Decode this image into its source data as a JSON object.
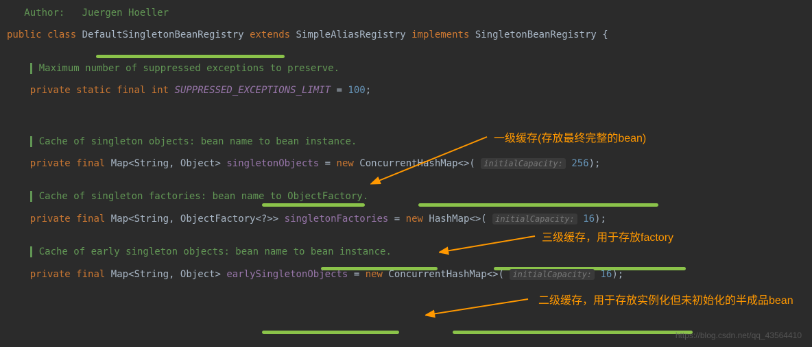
{
  "author_label": "Author:",
  "author_name": "Juergen Hoeller",
  "class_decl": {
    "public": "public",
    "class": "class",
    "name": "DefaultSingletonBeanRegistry",
    "extends": "extends",
    "parent": "SimpleAliasRegistry",
    "implements": "implements",
    "iface": "SingletonBeanRegistry",
    "brace": "{"
  },
  "comment1": "Maximum number of suppressed exceptions to preserve.",
  "field1": {
    "private": "private",
    "static": "static",
    "final": "final",
    "type": "int",
    "name": "SUPPRESSED_EXCEPTIONS_LIMIT",
    "eq": "=",
    "value": "100",
    "semi": ";"
  },
  "annotation1": "一级缓存(存放最终完整的bean)",
  "comment2": "Cache of singleton objects: bean name to bean instance.",
  "field2": {
    "private": "private",
    "final": "final",
    "type": "Map<String, Object>",
    "name": "singletonObjects",
    "eq": "=",
    "new": "new",
    "impl": "ConcurrentHashMap<>(",
    "hint": "initialCapacity:",
    "value": "256",
    "close": ");"
  },
  "annotation2": "三级缓存，用于存放factory",
  "comment3": "Cache of singleton factories: bean name to ObjectFactory.",
  "field3": {
    "private": "private",
    "final": "final",
    "type": "Map<String, ObjectFactory<?>>",
    "name": "singletonFactories",
    "eq": "=",
    "new": "new",
    "impl": "HashMap<>(",
    "hint": "initialCapacity:",
    "value": "16",
    "close": ");"
  },
  "annotation3": "二级缓存，用于存放实例化但未初始化的半成品bean",
  "comment4": "Cache of early singleton objects: bean name to bean instance.",
  "field4": {
    "private": "private",
    "final": "final",
    "type": "Map<String, Object>",
    "name": "earlySingletonObjects",
    "eq": "=",
    "new": "new",
    "impl": "ConcurrentHashMap<>(",
    "hint": "initialCapacity:",
    "value": "16",
    "close": ");"
  },
  "watermark": "https://blog.csdn.net/qq_43564410"
}
